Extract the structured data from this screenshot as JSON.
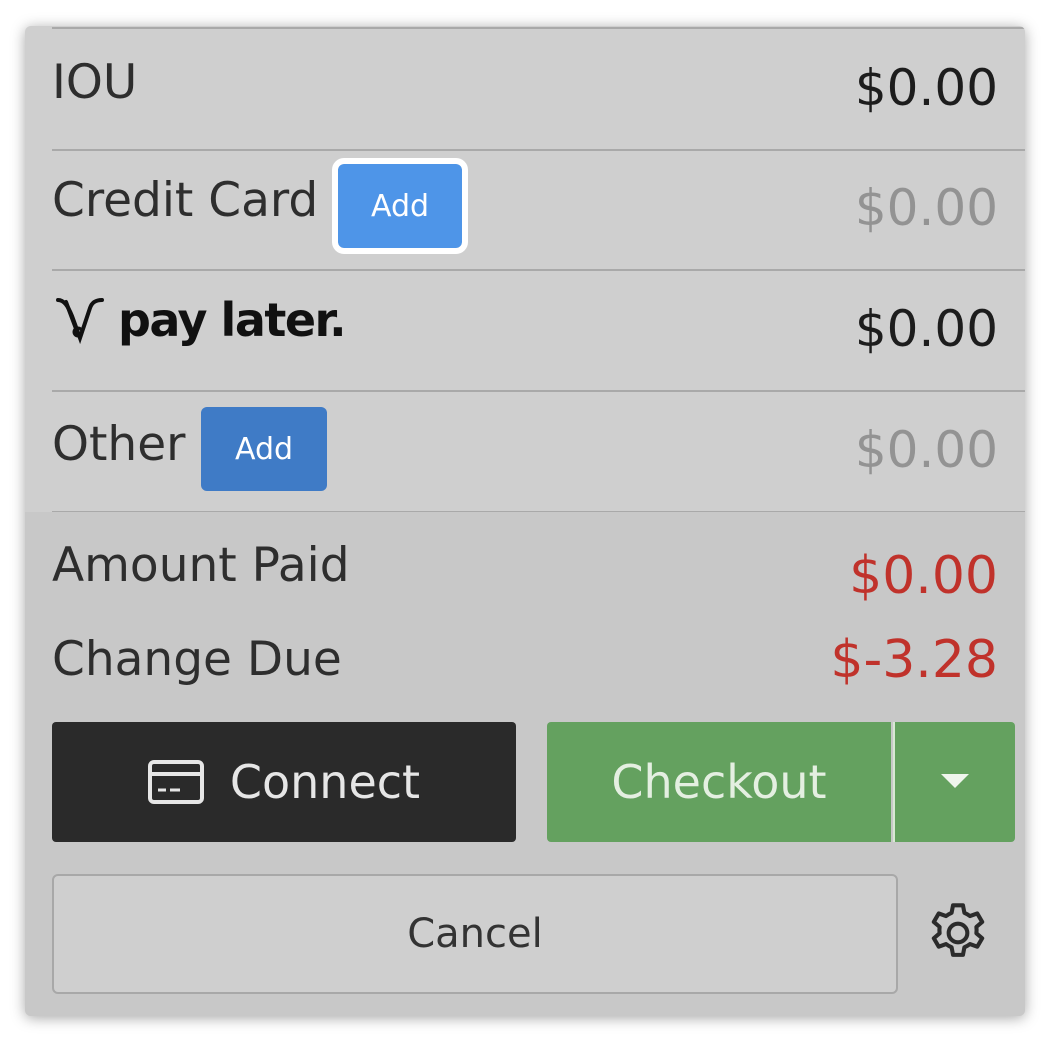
{
  "payments": {
    "iou": {
      "label": "IOU",
      "amount": "$0.00"
    },
    "credit_card": {
      "label": "Credit Card",
      "add_label": "Add",
      "amount": "$0.00"
    },
    "pay_later": {
      "logo_text": "pay later.",
      "amount": "$0.00"
    },
    "other": {
      "label": "Other",
      "add_label": "Add",
      "amount": "$0.00"
    }
  },
  "totals": {
    "amount_paid_label": "Amount Paid",
    "amount_paid_value": "$0.00",
    "change_due_label": "Change Due",
    "change_due_value": "$-3.28"
  },
  "actions": {
    "connect_label": "Connect",
    "checkout_label": "Checkout",
    "cancel_label": "Cancel"
  },
  "icons": {
    "connect": "credit-card-icon",
    "dropdown": "caret-down-icon",
    "settings": "gear-icon",
    "pay_later_logo": "v-logo-icon"
  },
  "colors": {
    "panel_bg": "#cfcfcf",
    "add_button_blue": "#4e95e8",
    "add_button_blue_dark": "#3f7bc6",
    "negative_red": "#c0322b",
    "connect_dark": "#2a2a2a",
    "checkout_green": "#64a15f"
  }
}
